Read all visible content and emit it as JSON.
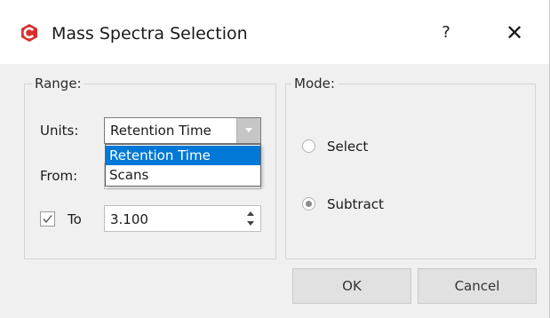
{
  "window": {
    "title": "Mass Spectra Selection",
    "help_label": "?",
    "close_label": "✕",
    "app_icon": "app-logo-icon",
    "accent_color": "#d6312f"
  },
  "range": {
    "group_title": "Range:",
    "units_label": "Units:",
    "units_value": "Retention Time",
    "dropdown_options": [
      "Retention Time",
      "Scans"
    ],
    "selected_option": "Retention Time",
    "from_label": "From:",
    "to_checked": true,
    "to_label": "To",
    "to_value": "3.100"
  },
  "mode": {
    "group_title": "Mode:",
    "options": [
      {
        "label": "Select",
        "checked": false
      },
      {
        "label": "Subtract",
        "checked": true
      }
    ]
  },
  "buttons": {
    "ok": "OK",
    "cancel": "Cancel"
  },
  "colors": {
    "selection_highlight": "#0078d7",
    "client_background": "#f0f0f0",
    "button_background": "#e1e1e1"
  }
}
